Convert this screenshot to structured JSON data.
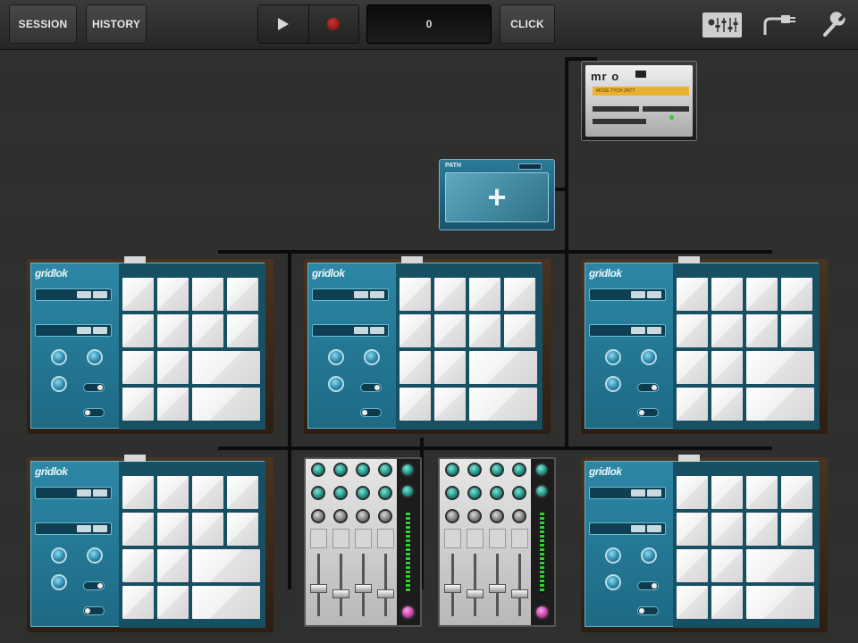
{
  "toolbar": {
    "session_label": "SESSION",
    "history_label": "HISTORY",
    "click_label": "CLICK",
    "counter_value": "0",
    "play_icon": "play-icon",
    "record_icon": "record-icon",
    "mixer_icon": "mixer-faders-icon",
    "connection_icon": "cable-plug-icon",
    "settings_icon": "wrench-icon"
  },
  "devices": {
    "mro": {
      "logo": "mr o",
      "screen_text": "MOSE TYCH 2NTT"
    },
    "path": {
      "title": "PATH",
      "add_symbol": "+"
    },
    "drum_machines": [
      {
        "logo": "gridlok",
        "tag": ""
      },
      {
        "logo": "gridlok",
        "tag": ""
      },
      {
        "logo": "gridlok",
        "tag": ""
      },
      {
        "logo": "gridlok",
        "tag": ""
      },
      {
        "logo": "gridlok",
        "tag": ""
      }
    ]
  },
  "colors": {
    "background": "#2e2e2c",
    "drum_panel": "#2c87a5",
    "pad": "#ffffff",
    "mixer_knob_teal": "#1e8c80",
    "master_knob_pink": "#c43aa4",
    "record": "#c33333"
  }
}
